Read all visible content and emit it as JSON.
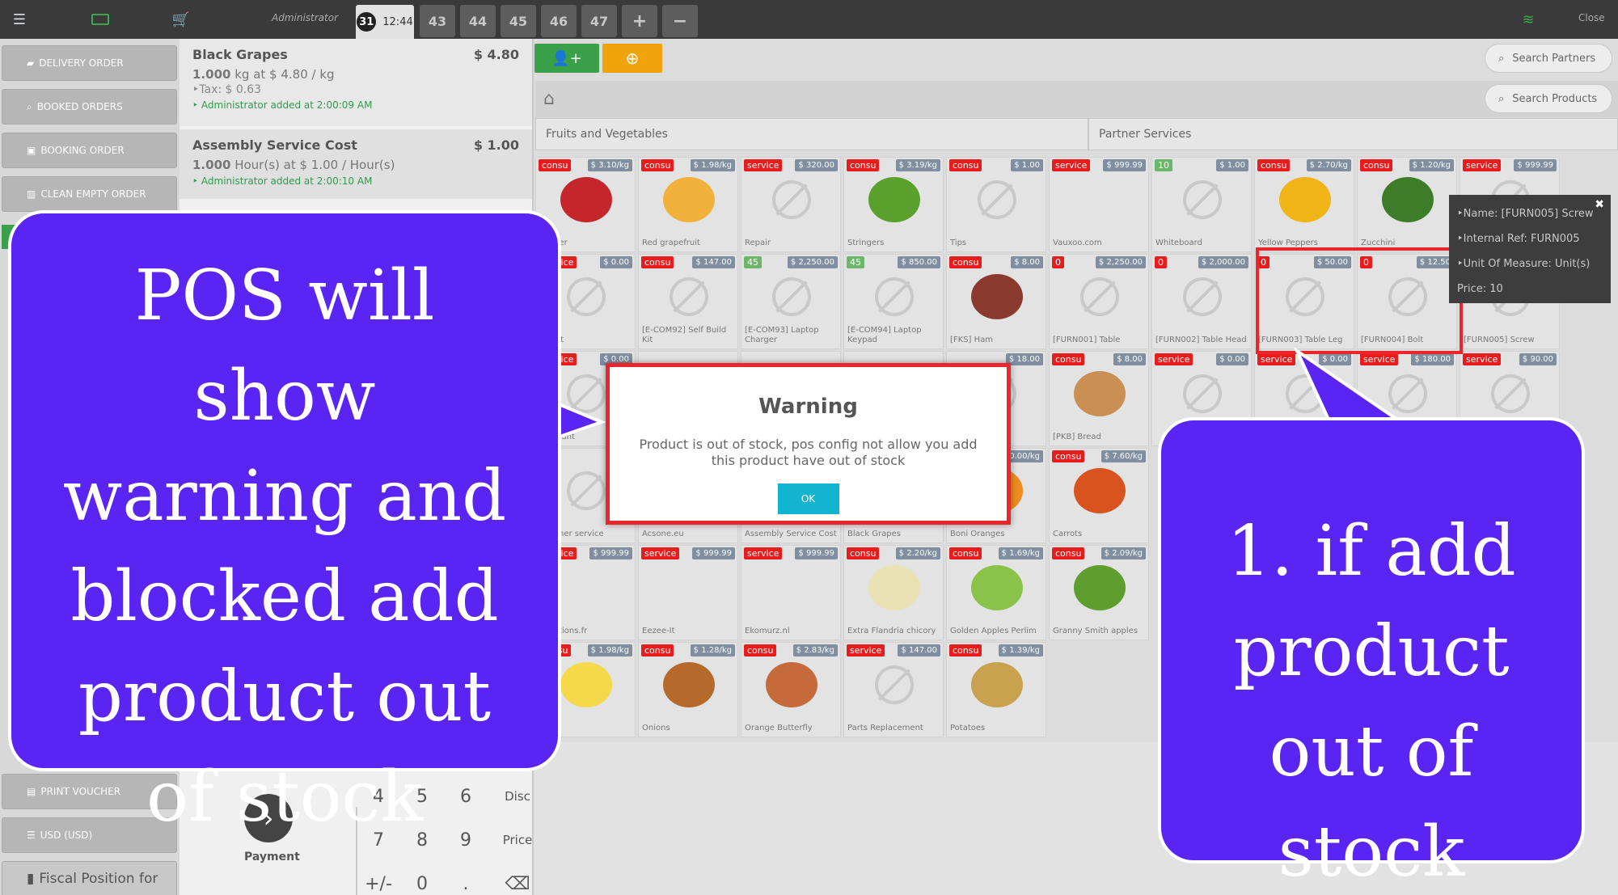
{
  "topbar": {
    "user": "Administrator",
    "active_tab": {
      "num": "31",
      "time": "12:44"
    },
    "tabs": [
      "43",
      "44",
      "45",
      "46",
      "47"
    ],
    "add_tab": "+",
    "remove_tab": "−",
    "close": "Close"
  },
  "left": {
    "buttons": [
      "DELIVERY ORDER",
      "BOOKED ORDERS",
      "BOOKING ORDER",
      "CLEAN EMPTY ORDER"
    ],
    "bottom_buttons": [
      "PRINT VOUCHER",
      "USD (USD)",
      "Fiscal Position for"
    ]
  },
  "order": {
    "lines": [
      {
        "name": "Black Grapes",
        "price": "$ 4.80",
        "qty": "1.000",
        "qty_text": " kg at $ 4.80 / kg",
        "tax": "Tax: $ 0.63",
        "note": "Administrator added at 2:00:09 AM"
      },
      {
        "name": "Assembly Service Cost",
        "price": "$ 1.00",
        "qty": "1.000",
        "qty_text": " Hour(s) at $ 1.00 / Hour(s)",
        "tax": "",
        "note": "Administrator added at 2:00:10 AM"
      }
    ],
    "payment_label": "Payment",
    "numpad": [
      [
        "4",
        "5",
        "6",
        "Disc"
      ],
      [
        "7",
        "8",
        "9",
        "Price"
      ],
      [
        "+/-",
        "0",
        ".",
        "⌫"
      ]
    ]
  },
  "search": {
    "partners": "Search Partners",
    "products": "Search Products"
  },
  "categories": [
    "Fruits and Vegetables",
    "Partner Services"
  ],
  "products": [
    [
      {
        "badge": "consu",
        "price": "$ 3.10/kg",
        "name": "Pepper",
        "img": "#c4262b"
      },
      {
        "badge": "consu",
        "price": "$ 1.98/kg",
        "name": "Red grapefruit",
        "img": "#f2b13a"
      },
      {
        "badge": "service",
        "price": "$ 320.00",
        "name": "Repair",
        "img": ""
      },
      {
        "badge": "consu",
        "price": "$ 3.19/kg",
        "name": "Stringers",
        "img": "#5aa02c"
      },
      {
        "badge": "consu",
        "price": "$ 1.00",
        "name": "Tips",
        "img": ""
      },
      {
        "badge": "service",
        "price": "$ 999.99",
        "name": "Vauxoo.com",
        "img": "logo"
      },
      {
        "badge": "10",
        "green": true,
        "price": "$ 1.00",
        "name": "Whiteboard",
        "img": ""
      },
      {
        "badge": "consu",
        "price": "$ 2.70/kg",
        "name": "Yellow Peppers",
        "img": "#f0b417"
      },
      {
        "badge": "consu",
        "price": "$ 1.20/kg",
        "name": "Zucchini",
        "img": "#3d7d2a"
      },
      {
        "badge": "service",
        "price": "$ 999.99",
        "name": "",
        "img": ""
      }
    ],
    [
      {
        "badge": "service",
        "price": "$ 0.00",
        "name": "Credit",
        "img": ""
      },
      {
        "badge": "consu",
        "price": "$ 147.00",
        "name": "[E-COM92] Self Build Kit",
        "img": ""
      },
      {
        "badge": "45",
        "green": true,
        "price": "$ 2,250.00",
        "name": "[E-COM93] Laptop Charger",
        "img": ""
      },
      {
        "badge": "45",
        "green": true,
        "price": "$ 850.00",
        "name": "[E-COM94] Laptop Keypad",
        "img": ""
      },
      {
        "badge": "consu",
        "price": "$ 8.00",
        "name": "[FKS] Ham",
        "img": "#8b3a2f"
      },
      {
        "badge": "0",
        "price": "$ 2,250.00",
        "name": "[FURN001] Table",
        "img": ""
      },
      {
        "badge": "0",
        "price": "$ 2,000.00",
        "name": "[FURN002] Table Head",
        "img": ""
      },
      {
        "badge": "0",
        "price": "$ 50.00",
        "name": "[FURN003] Table Leg",
        "img": ""
      },
      {
        "badge": "0",
        "price": "$ 12.50",
        "name": "[FURN004] Bolt",
        "img": ""
      },
      {
        "badge": "",
        "price": "",
        "name": "[FURN005] Screw",
        "img": ""
      }
    ],
    [
      {
        "badge": "service",
        "price": "$ 0.00",
        "name": "Discount",
        "img": ""
      },
      {
        "badge": "",
        "price": "",
        "name": "",
        "img": ""
      },
      {
        "badge": "",
        "price": "",
        "name": "",
        "img": ""
      },
      {
        "badge": "",
        "price": "",
        "name": "",
        "img": ""
      },
      {
        "badge": "",
        "price": "$ 18.00",
        "name": "neous",
        "img": ""
      },
      {
        "badge": "consu",
        "price": "$ 8.00",
        "name": "[PKB] Bread",
        "img": "#c98f53"
      },
      {
        "badge": "service",
        "price": "$ 0.00",
        "name": "",
        "img": ""
      },
      {
        "badge": "service",
        "price": "$ 0.00",
        "name": "",
        "img": ""
      },
      {
        "badge": "service",
        "price": "$ 180.00",
        "name": "",
        "img": ""
      },
      {
        "badge": "service",
        "price": "$ 90.00",
        "name": "",
        "img": ""
      }
    ],
    [
      {
        "badge": "",
        "price": "",
        "name": "Voucher service",
        "img": ""
      },
      {
        "badge": "",
        "price": "",
        "name": "Acsone.eu",
        "img": ""
      },
      {
        "badge": "",
        "price": "",
        "name": "Assembly Service Cost",
        "img": ""
      },
      {
        "badge": "",
        "price": "",
        "name": "Black Grapes",
        "img": ""
      },
      {
        "badge": "",
        "price": "0.00/kg",
        "name": "Boni Oranges",
        "img": "#f08c1d"
      },
      {
        "badge": "consu",
        "price": "$ 7.60/kg",
        "name": "Carrots",
        "img": "#d9531e"
      }
    ],
    [
      {
        "badge": "service",
        "price": "$ 999.99",
        "name": "-solutions.fr",
        "img": "ggs"
      },
      {
        "badge": "service",
        "price": "$ 999.99",
        "name": "Eezee-It",
        "img": "eezee"
      },
      {
        "badge": "service",
        "price": "$ 999.99",
        "name": "Ekomurz.nl",
        "img": "ekomurz"
      },
      {
        "badge": "consu",
        "price": "$ 2.20/kg",
        "name": "Extra Flandria chicory",
        "img": "#e8e2b4"
      },
      {
        "badge": "consu",
        "price": "$ 1.69/kg",
        "name": "Golden Apples Perlim",
        "img": "#8bc34a"
      },
      {
        "badge": "consu",
        "price": "$ 2.09/kg",
        "name": "Granny Smith apples",
        "img": "#5e9e2e"
      }
    ],
    [
      {
        "badge": "consu",
        "price": "$ 1.98/kg",
        "name": "n",
        "img": "#f5d94a"
      },
      {
        "badge": "consu",
        "price": "$ 1.28/kg",
        "name": "Onions",
        "img": "#b56a2c"
      },
      {
        "badge": "consu",
        "price": "$ 2.83/kg",
        "name": "Orange Butterfly",
        "img": "#c46a3b"
      },
      {
        "badge": "service",
        "price": "$ 147.00",
        "name": "Parts Replacement",
        "img": ""
      },
      {
        "badge": "consu",
        "price": "$ 1.39/kg",
        "name": "Potatoes",
        "img": "#c8a24f"
      }
    ]
  ],
  "tooltip": {
    "lines": [
      "Name: [FURN005] Screw",
      "Internal Ref: FURN005",
      "Unit Of Measure: Unit(s)",
      "Price: 10"
    ]
  },
  "modal": {
    "title": "Warning",
    "message": "Product is out of stock, pos config not allow you add this product have out of stock",
    "ok": "OK"
  },
  "callouts": {
    "left": "POS will show warning and blocked add product out of stock",
    "right": "1. if add product out of stock"
  },
  "colors": {
    "accent_red": "#e8262b",
    "callout": "#5a24f3",
    "ok_button": "#12b4cf",
    "green": "#5cb85c",
    "orange": "#f0a30a"
  }
}
